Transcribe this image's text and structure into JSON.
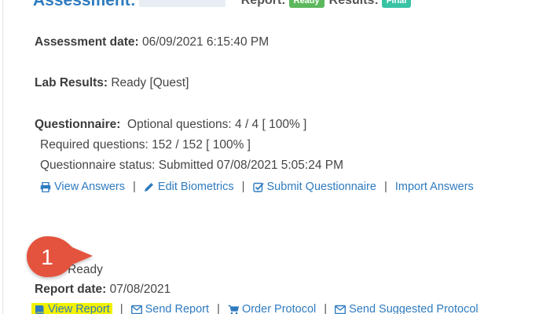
{
  "header": {
    "assessment_label": "Assessment:",
    "report_label": "Report:",
    "report_badge": "Ready",
    "results_label": "Results:",
    "results_badge": "Final"
  },
  "assessment_date": {
    "label": "Assessment date:",
    "value": "06/09/2021 6:15:40 PM"
  },
  "lab_results": {
    "label": "Lab Results:",
    "value": "Ready [Quest]"
  },
  "questionnaire": {
    "label": "Questionnaire:",
    "optional": "Optional questions: 4 / 4 [ 100% ]",
    "required": "Required questions: 152 / 152 [ 100% ]",
    "status": "Questionnaire status: Submitted 07/08/2021 5:05:24 PM",
    "links": {
      "view_answers": "View Answers",
      "edit_biometrics": "Edit Biometrics",
      "submit_questionnaire": "Submit Questionnaire",
      "import_answers": "Import Answers"
    }
  },
  "report": {
    "status_label": "s:",
    "status_value": "Ready",
    "date_label": "Report date:",
    "date_value": "07/08/2021",
    "links": {
      "view_report": "View Report",
      "send_report": "Send Report",
      "order_protocol": "Order Protocol",
      "send_suggested_protocol": "Send Suggested Protocol"
    }
  },
  "callout": {
    "number": "1",
    "color": "#e4533c"
  },
  "colors": {
    "link": "#2f7bbf",
    "highlight": "#f4f100",
    "ready_badge": "#5cb85c",
    "final_badge": "#38c3a5"
  }
}
